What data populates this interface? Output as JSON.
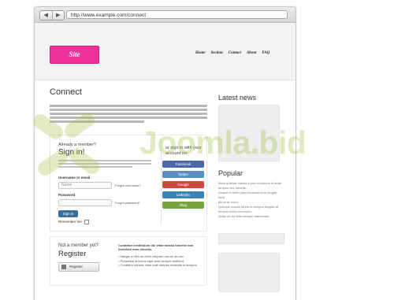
{
  "browser": {
    "back_icon": "back-arrow-icon",
    "forward_icon": "forward-arrow-icon",
    "url": "http://www.example.com/connect"
  },
  "header": {
    "logo": "Site",
    "nav": [
      "Home",
      "Section",
      "Contact",
      "About",
      "FAQ"
    ]
  },
  "main": {
    "title": "Connect",
    "login": {
      "already_member": "Already a member?",
      "sign_in_title": "Sign in!",
      "username_label": "Username or email",
      "username_value": "Name",
      "password_label": "Password",
      "forgot_username": "Forgot username?",
      "forgot_password": "Forgot password?",
      "sign_in_button": "Sign in",
      "remember_me": "Remember me",
      "social_title": "or sign in with your account on:",
      "social": [
        {
          "label": "Facebook",
          "color": "#4b67a8"
        },
        {
          "label": "Twitter",
          "color": "#5b8fbd"
        },
        {
          "label": "Google",
          "color": "#d0483d"
        },
        {
          "label": "LinkedIn",
          "color": "#3c84b4"
        },
        {
          "label": "Blog",
          "color": "#78a33f"
        }
      ]
    },
    "register": {
      "not_member": "Not a member yet?",
      "title": "Register",
      "intro": "Curabitur vestibulum dui vitae massa lobortis non tincidunt eros lobortis.",
      "bullets": [
        "Integer a nibh ac dolor aliquam rutrum ac nec.",
        "Phasellus id lectus eget ante semper eleifend.",
        "Curabitur ultrices vitae erat ultricies molestie in tempus."
      ],
      "button": "Register"
    }
  },
  "sidebar": {
    "news_title": "Latest news",
    "popular_title": "Popular",
    "popular_items": [
      "Nulla gravida massa a pos commodo id amet",
      "tempus nec lobortis.",
      "Aliquet id amet justo tincidunt urna feugiat tortu",
      "pis at ac dolor.",
      "Quisque mauris lorem in tempus fringilla at",
      "tempus enim commodo.",
      "Nulla vel dui felis semper maecenas."
    ]
  },
  "watermark": "Joomla.bid",
  "colors": {
    "logo_pink": "#f0309a",
    "signin_blue": "#3b6f9e",
    "watermark_green": "#a0be3c"
  }
}
